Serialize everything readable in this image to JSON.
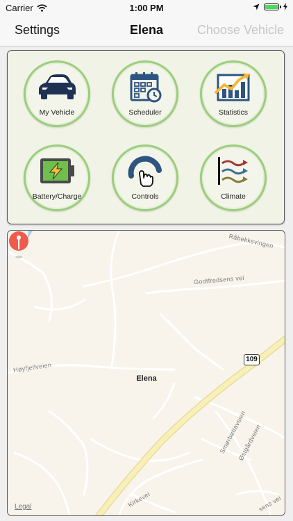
{
  "status_bar": {
    "carrier": "Carrier",
    "time": "1:00 PM"
  },
  "nav": {
    "left": "Settings",
    "title": "Elena",
    "right": "Choose Vehicle"
  },
  "menu": {
    "items": [
      {
        "label": "My Vehicle",
        "icon": "car-icon"
      },
      {
        "label": "Scheduler",
        "icon": "calendar-clock-icon"
      },
      {
        "label": "Statistics",
        "icon": "chart-icon"
      },
      {
        "label": "Battery/Charge",
        "icon": "battery-icon"
      },
      {
        "label": "Controls",
        "icon": "touch-gauge-icon"
      },
      {
        "label": "Climate",
        "icon": "airflow-icon"
      }
    ]
  },
  "map": {
    "pin_label": "Elena",
    "route_shield": "109",
    "legal": "Legal",
    "roads": [
      "Råbekksvingen",
      "Godtfredsens vei",
      "Høyfjellveien",
      "Smørbøttaveien",
      "Østgårdveien",
      "Kirkevei",
      "sens vei"
    ]
  },
  "colors": {
    "tile_border": "#9ccd7c",
    "panel_bg": "#f0f3e6",
    "pin": "#f05a4a",
    "highway": "#f9f0b8"
  }
}
